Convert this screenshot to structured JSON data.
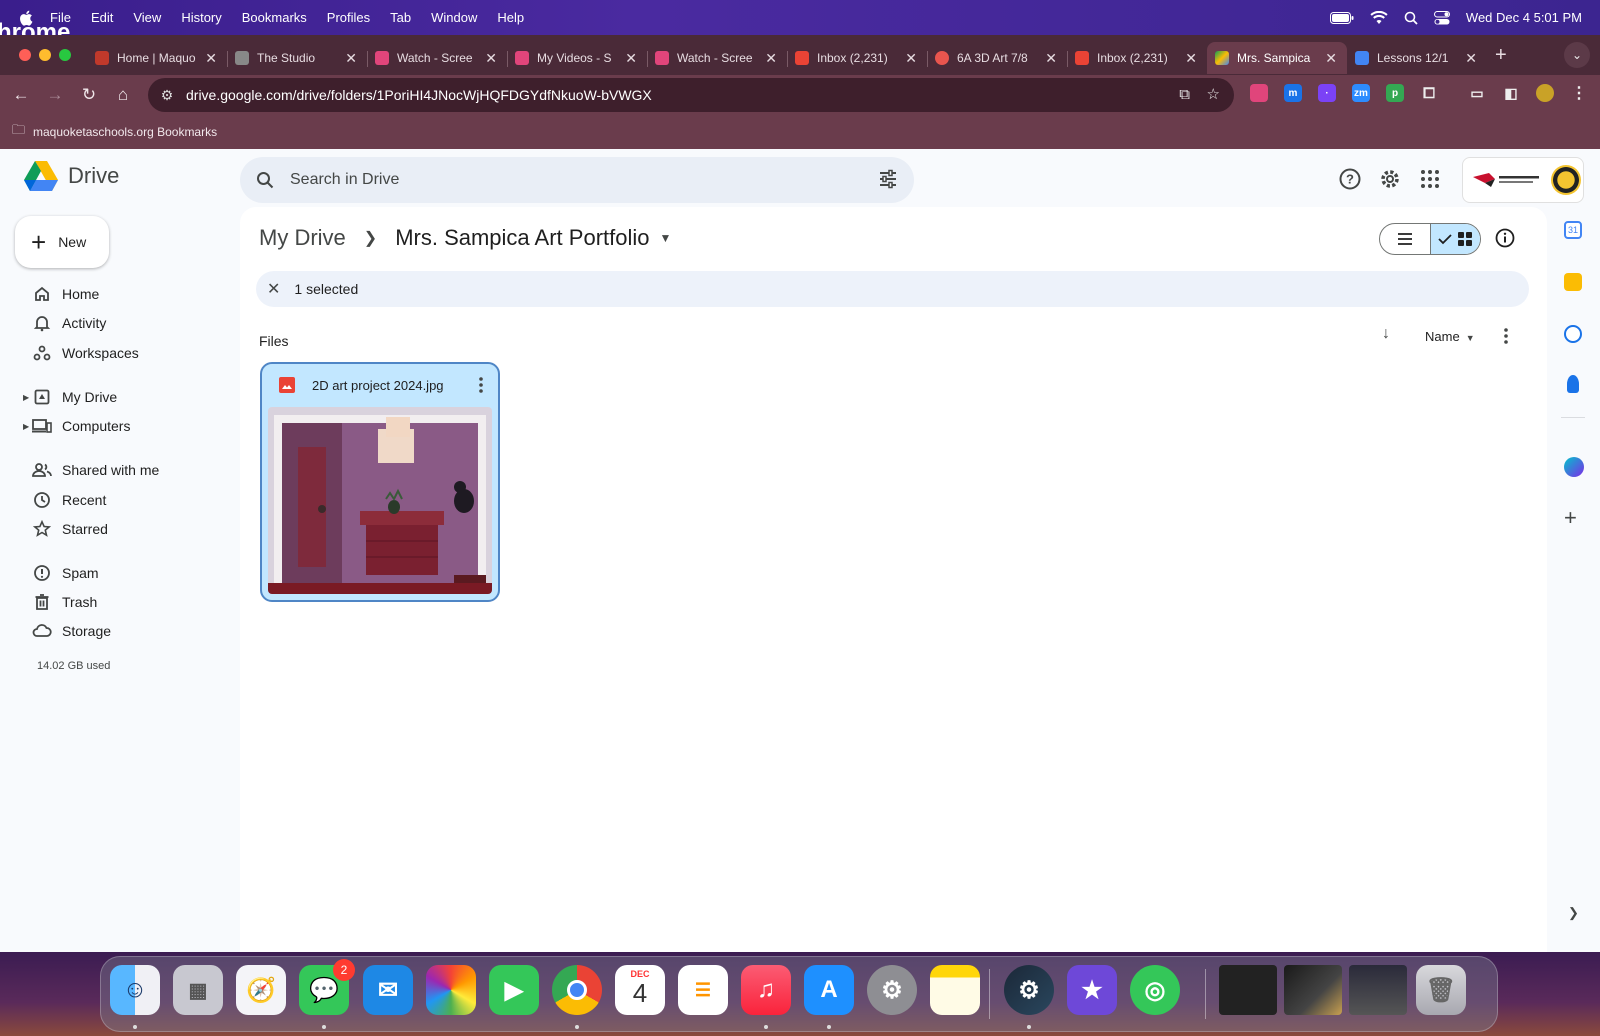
{
  "menubar": {
    "app_name": "Chrome",
    "items": [
      "File",
      "Edit",
      "View",
      "History",
      "Bookmarks",
      "Profiles",
      "Tab",
      "Window",
      "Help"
    ],
    "datetime": "Wed Dec 4  5:01 PM"
  },
  "tabs": [
    {
      "title": "Home | Maquo",
      "favicon_color": "#c0392b"
    },
    {
      "title": "The Studio",
      "favicon_color": "#888888"
    },
    {
      "title": "Watch - Scree",
      "favicon_color": "#e0457b"
    },
    {
      "title": "My Videos - S",
      "favicon_color": "#e0457b"
    },
    {
      "title": "Watch - Scree",
      "favicon_color": "#e0457b"
    },
    {
      "title": "Inbox (2,231)",
      "favicon_color": "#ea4335"
    },
    {
      "title": "6A 3D Art 7/8",
      "favicon_color": "#e8554e"
    },
    {
      "title": "Inbox (2,231)",
      "favicon_color": "#ea4335"
    },
    {
      "title": "Mrs. Sampica",
      "favicon_color": "#fbbc04",
      "active": true
    },
    {
      "title": "Lessons 12/1",
      "favicon_color": "#4285f4"
    }
  ],
  "omnibox": {
    "url": "drive.google.com/drive/folders/1PoriHI4JNocWjHQFDGYdfNkuoW-bVWGX"
  },
  "bookmarks_bar": {
    "folder_label": "maquoketaschools.org Bookmarks"
  },
  "drive": {
    "app_name": "Drive",
    "search_placeholder": "Search in Drive",
    "new_button": "New",
    "nav": {
      "home": "Home",
      "activity": "Activity",
      "workspaces": "Workspaces",
      "my_drive": "My Drive",
      "computers": "Computers",
      "shared": "Shared with me",
      "recent": "Recent",
      "starred": "Starred",
      "spam": "Spam",
      "trash": "Trash",
      "storage": "Storage"
    },
    "storage_used": "14.02 GB used",
    "breadcrumb": {
      "root": "My Drive",
      "current": "Mrs. Sampica Art Portfolio"
    },
    "selection_text": "1 selected",
    "section_title": "Files",
    "sort_label": "Name",
    "files": [
      {
        "name": "2D art project 2024.jpg",
        "type": "image"
      }
    ]
  },
  "dock": {
    "messages_badge": "2",
    "calendar_month": "DEC",
    "calendar_day": "4"
  },
  "colors": {
    "drive_selected": "#c2e7ff",
    "drive_accent": "#0b57d0"
  }
}
